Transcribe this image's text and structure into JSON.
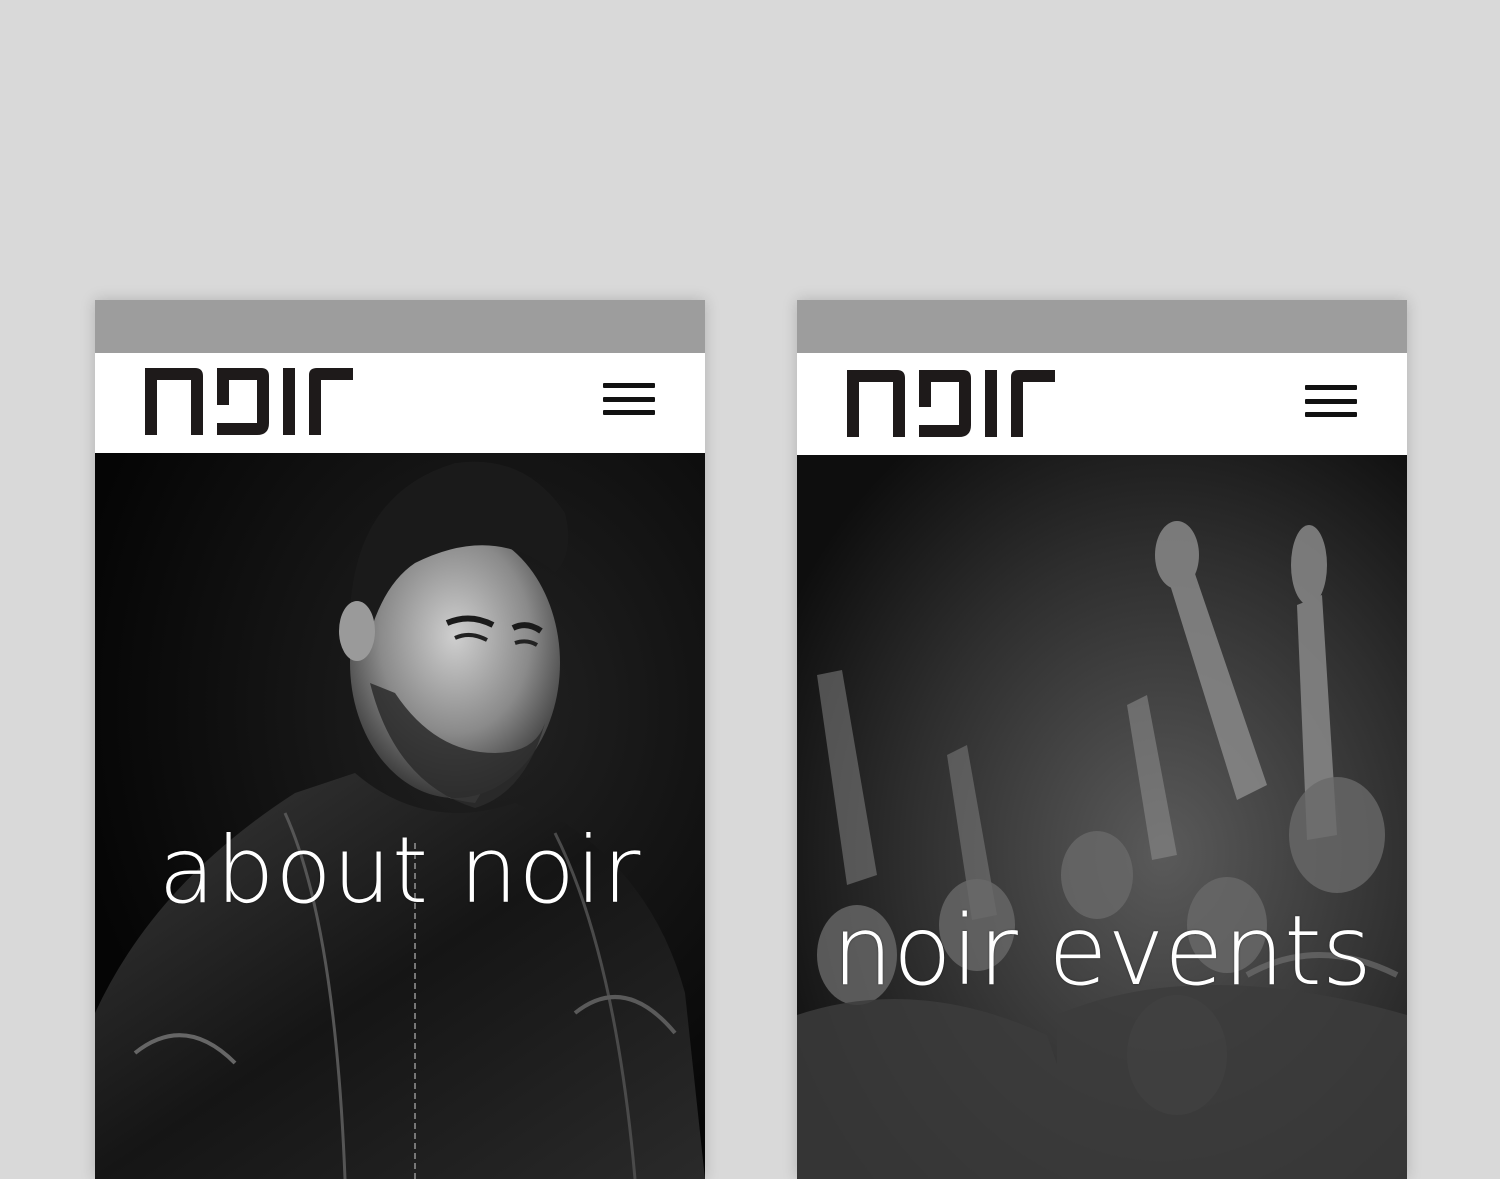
{
  "screens": [
    {
      "brand": "noir",
      "hero_title": "about noir",
      "icons": {
        "menu": "hamburger-menu-icon",
        "logo": "noir-logo"
      }
    },
    {
      "brand": "noir",
      "hero_title": "noir events",
      "icons": {
        "menu": "hamburger-menu-icon",
        "logo": "noir-logo"
      }
    }
  ],
  "colors": {
    "background": "#d9d9d9",
    "status_bar": "#9d9d9d",
    "header": "#ffffff",
    "logo": "#1e1a1a",
    "hero_text": "#ffffff"
  }
}
